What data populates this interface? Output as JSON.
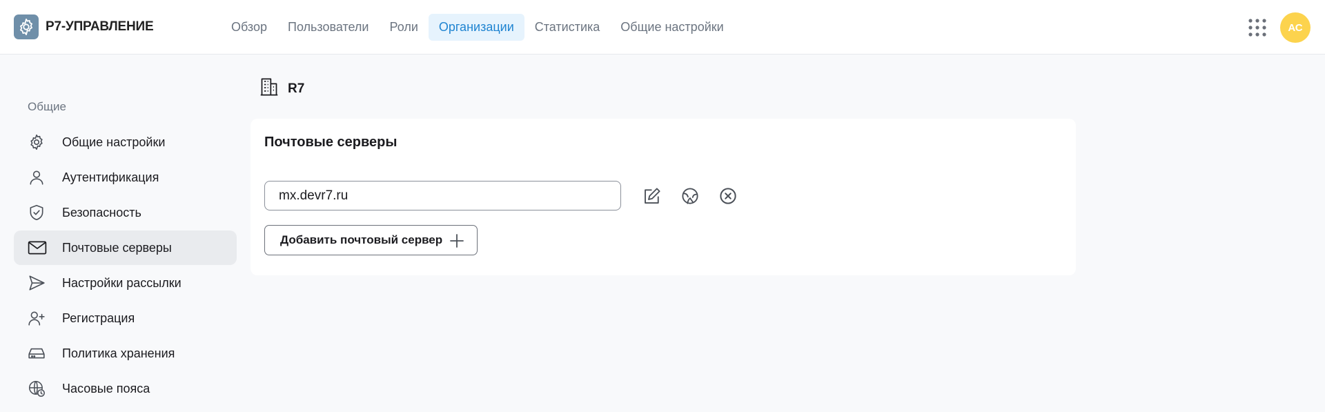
{
  "app": {
    "name": "Р7-УПРАВЛЕНИЕ"
  },
  "topnav": {
    "items": [
      {
        "label": "Обзор",
        "active": false
      },
      {
        "label": "Пользователи",
        "active": false
      },
      {
        "label": "Роли",
        "active": false
      },
      {
        "label": "Организации",
        "active": true
      },
      {
        "label": "Статистика",
        "active": false
      },
      {
        "label": "Общие настройки",
        "active": false
      }
    ]
  },
  "user": {
    "initials": "АС",
    "avatar_color": "#fcd34d"
  },
  "sidebar": {
    "group_label": "Общие",
    "items": [
      {
        "label": "Общие настройки",
        "icon": "gear-icon"
      },
      {
        "label": "Аутентификация",
        "icon": "user-icon"
      },
      {
        "label": "Безопасность",
        "icon": "shield-check-icon"
      },
      {
        "label": "Почтовые серверы",
        "icon": "mail-icon",
        "active": true
      },
      {
        "label": "Настройки рассылки",
        "icon": "send-icon"
      },
      {
        "label": "Регистрация",
        "icon": "user-plus-icon"
      },
      {
        "label": "Политика хранения",
        "icon": "storage-icon"
      },
      {
        "label": "Часовые пояса",
        "icon": "globe-clock-icon"
      }
    ]
  },
  "page": {
    "title": "R7"
  },
  "mail_servers": {
    "title": "Почтовые серверы",
    "servers": [
      {
        "value": "mx.devr7.ru"
      }
    ],
    "add_button_label": "Добавить почтовый сервер"
  },
  "colors": {
    "accent": "#1f84d1",
    "active_tab_bg": "#e6f3fd",
    "logo": "#6f8fa9",
    "sidebar_active_bg": "#e9ebee"
  }
}
